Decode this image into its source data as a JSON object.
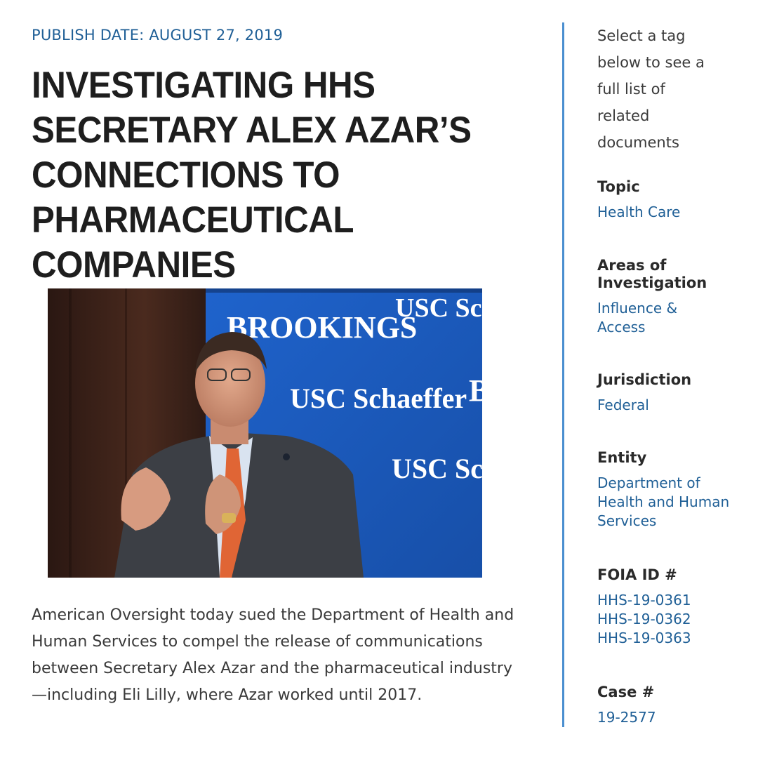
{
  "article": {
    "publish_date": "PUBLISH DATE: AUGUST 27, 2019",
    "title": "INVESTIGATING HHS SECRETARY ALEX AZAR’S CONNECTIONS TO PHARMACEUTICAL COMPANIES",
    "photo": {
      "backdrop_texts": [
        "BROOKINGS",
        "USC Schaeffer",
        "USC Schaeffer",
        "USC Schaef",
        "B"
      ]
    },
    "body": "American Oversight today sued the Department of Health and Human Services to compel the release of communications between Secretary Alex Azar and the pharmaceutical industry —including Eli Lilly, where Azar worked until 2017."
  },
  "sidebar": {
    "intro": "Select a tag below to see a full list of related documents",
    "groups": [
      {
        "heading": "Topic",
        "links": [
          "Health Care"
        ]
      },
      {
        "heading": "Areas of Investigation",
        "links": [
          "Influence & Access"
        ]
      },
      {
        "heading": "Jurisdiction",
        "links": [
          "Federal"
        ]
      },
      {
        "heading": "Entity",
        "links": [
          "Department of Health and Human Services"
        ]
      },
      {
        "heading": "FOIA ID #",
        "links": [
          "HHS-19-0361",
          "HHS-19-0362",
          "HHS-19-0363"
        ]
      },
      {
        "heading": "Case #",
        "links": [
          "19-2577"
        ]
      }
    ]
  },
  "colors": {
    "link": "#1f5f96",
    "divider": "#4a8fd0",
    "backdrop_blue": "#1d5fc4"
  }
}
